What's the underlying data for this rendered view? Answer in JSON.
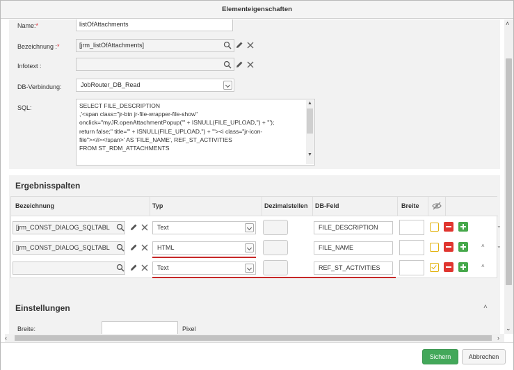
{
  "window": {
    "title": "Elementeigenschaften"
  },
  "form": {
    "name_label": "Name:",
    "name_req": "*",
    "name_value": "listOfAttachments",
    "bezeichnung_label": "Bezeichnung :",
    "bezeichnung_req": "*",
    "bezeichnung_value": "[jrm_listOfAttachments]",
    "infotext_label": "Infotext :",
    "infotext_value": "",
    "db_label": "DB-Verbindung:",
    "db_value": "JobRouter_DB_Read",
    "sql_label": "SQL:",
    "sql_lines": [
      "SELECT FILE_DESCRIPTION",
      ",'<span class=\"jr-btn jr-file-wrapper-file-show\"",
      "onclick=\"myJR.openAttachmentPopup(''' + ISNULL(FILE_UPLOAD,'') + ''');",
      "return false;\" title=\"' + ISNULL(FILE_UPLOAD,'') + '\"><i class=\"jr-icon-",
      "file\"></i></span>' AS 'FILE_NAME', REF_ST_ACTIVITIES",
      "FROM ST_RDM_ATTACHMENTS"
    ]
  },
  "ergebnis": {
    "title": "Ergebnisspalten",
    "headers": {
      "bezeichnung": "Bezeichnung",
      "typ": "Typ",
      "dezimal": "Dezimalstellen",
      "dbfeld": "DB-Feld",
      "breite": "Breite"
    },
    "rows": [
      {
        "bezeichnung": "[jrm_CONST_DIALOG_SQLTABL",
        "typ": "Text",
        "dbfeld": "FILE_DESCRIPTION",
        "breite": ""
      },
      {
        "bezeichnung": "[jrm_CONST_DIALOG_SQLTABL",
        "typ": "HTML",
        "dbfeld": "FILE_NAME",
        "breite": ""
      },
      {
        "bezeichnung": "",
        "typ": "Text",
        "dbfeld": "REF_ST_ACTIVITIES",
        "breite": ""
      }
    ]
  },
  "einstellungen": {
    "title": "Einstellungen",
    "breite_label": "Breite:",
    "breite_value": "",
    "pixel_label": "Pixel"
  },
  "footer": {
    "save": "Sichern",
    "cancel": "Abbrechen"
  },
  "colors": {
    "primary": "#43a85a",
    "danger": "#e0352f",
    "success": "#46a84b",
    "warn": "#e2b20e",
    "required": "#d9242f"
  },
  "icons": [
    "search-icon",
    "pencil-icon",
    "close-icon",
    "eye-slash-icon",
    "chevron-down-icon",
    "chevron-up-icon"
  ]
}
